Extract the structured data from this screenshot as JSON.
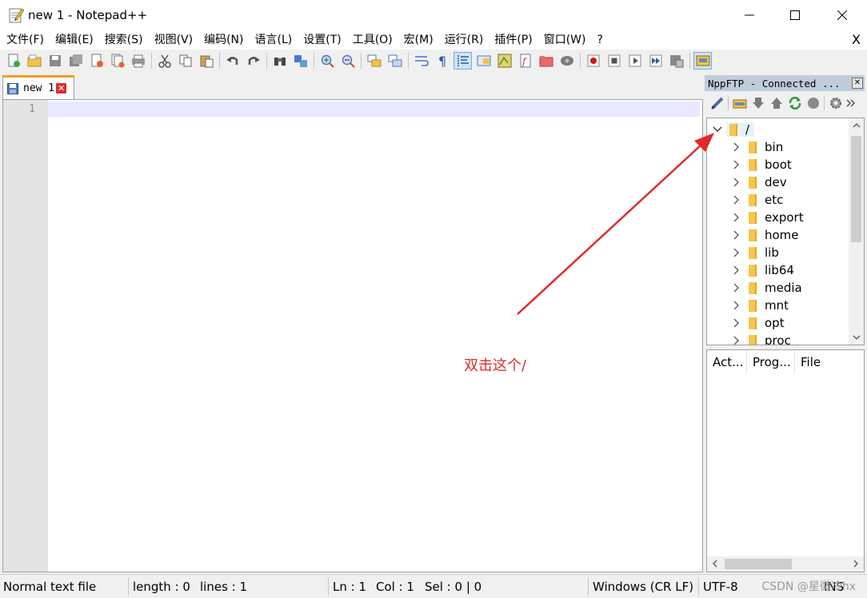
{
  "window": {
    "title": "new 1 - Notepad++",
    "minimize": "—",
    "maximize": "☐",
    "close": "✕"
  },
  "menu": {
    "items": [
      "文件(F)",
      "编辑(E)",
      "搜索(S)",
      "视图(V)",
      "编码(N)",
      "语言(L)",
      "设置(T)",
      "工具(O)",
      "宏(M)",
      "运行(R)",
      "插件(P)",
      "窗口(W)",
      "?"
    ],
    "close": "X"
  },
  "tabs": [
    {
      "label": "new 1",
      "close": "✕"
    }
  ],
  "editor": {
    "line_numbers": [
      "1"
    ],
    "annotation": "双击这个/"
  },
  "panel": {
    "title": "NppFTP - Connected ...",
    "close": "✕",
    "tree": {
      "root": "/",
      "folders": [
        "bin",
        "boot",
        "dev",
        "etc",
        "export",
        "home",
        "lib",
        "lib64",
        "media",
        "mnt",
        "opt",
        "proc"
      ]
    },
    "queue_columns": [
      "Act...",
      "Prog...",
      "File"
    ]
  },
  "status": {
    "file_type": "Normal text file",
    "length": "length : 0",
    "lines": "lines : 1",
    "ln": "Ln : 1",
    "col": "Col : 1",
    "sel": "Sel : 0 | 0",
    "eol": "Windows (CR LF)",
    "encoding": "UTF-8",
    "mode": "INS",
    "watermark": "CSDN @星微冷hx"
  },
  "colors": {
    "tab_accent": "#f4a020",
    "annotation": "#e02a2a",
    "panel_title_bg": "#bfcddb",
    "current_line": "#e8e8ff",
    "folder": "#f5c74a"
  }
}
